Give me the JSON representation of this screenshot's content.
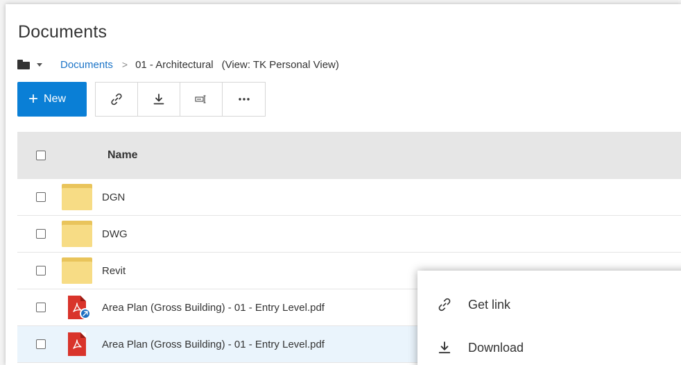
{
  "page": {
    "title": "Documents"
  },
  "breadcrumb": {
    "root": "Documents",
    "separator": ">",
    "current": "01 - Architectural",
    "view": "(View: TK Personal View)"
  },
  "toolbar": {
    "new_label": "New",
    "new_icon": "plus-icon",
    "buttons": [
      {
        "icon": "link-icon"
      },
      {
        "icon": "download-icon"
      },
      {
        "icon": "rename-icon"
      },
      {
        "icon": "more-icon"
      }
    ]
  },
  "table": {
    "columns": [
      "Name"
    ],
    "rows": [
      {
        "name": "DGN",
        "type": "folder",
        "icon": "folder-icon"
      },
      {
        "name": "DWG",
        "type": "folder",
        "icon": "folder-icon"
      },
      {
        "name": "Revit",
        "type": "folder",
        "icon": "folder-icon"
      },
      {
        "name": "Area Plan (Gross Building) - 01 - Entry Level.pdf",
        "type": "pdf",
        "icon": "pdf-shared-icon"
      },
      {
        "name": "Area Plan (Gross Building) - 01 - Entry Level.pdf",
        "type": "pdf",
        "icon": "pdf-icon",
        "selected": true
      }
    ]
  },
  "context_menu": {
    "items": [
      {
        "label": "Get link",
        "icon": "link-icon"
      },
      {
        "label": "Download",
        "icon": "download-icon"
      }
    ]
  },
  "colors": {
    "accent": "#0a7fd6",
    "link": "#1a73c7",
    "header_bg": "#e6e6e6",
    "folder": "#f7dc85",
    "pdf": "#d9342b",
    "selected_row": "#eaf4fc"
  }
}
